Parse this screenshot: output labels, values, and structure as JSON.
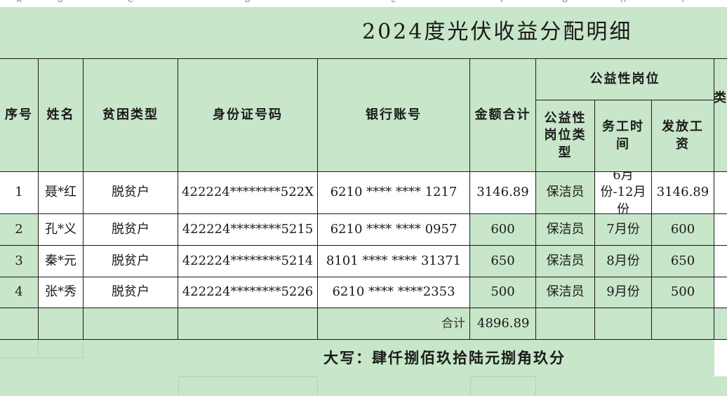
{
  "column_letters": [
    "A",
    "B",
    "C",
    "D",
    "E",
    "F",
    "G",
    "H",
    "I"
  ],
  "title": "2024度光伏收益分配明细",
  "headers": {
    "seq": "序号",
    "name": "姓名",
    "poverty_type": "贫困类型",
    "id_number": "身份证号码",
    "bank_account": "银行账号",
    "amount_total": "金额合计",
    "public_post_group": "公益性岗位",
    "post_type": "公益性岗位类型",
    "work_time": "务工时间",
    "wage": "发放工资",
    "clipped": "类"
  },
  "rows": [
    {
      "seq": "1",
      "name": "聂*红",
      "poverty_type": "脱贫户",
      "id_number": "422224********522X",
      "bank_account": "6210 **** **** 1217",
      "amount": "3146.89",
      "post_type": "保洁员",
      "work_time": "6月份-12月份",
      "wage": "3146.89"
    },
    {
      "seq": "2",
      "name": "孔*义",
      "poverty_type": "脱贫户",
      "id_number": "422224********5215",
      "bank_account": "6210 **** **** 0957",
      "amount": "600",
      "post_type": "保洁员",
      "work_time": "7月份",
      "wage": "600"
    },
    {
      "seq": "3",
      "name": "秦*元",
      "poverty_type": "脱贫户",
      "id_number": "422224********5214",
      "bank_account": "8101 **** **** 31371",
      "amount": "650",
      "post_type": "保洁员",
      "work_time": "8月份",
      "wage": "650"
    },
    {
      "seq": "4",
      "name": "张*秀",
      "poverty_type": "脱贫户",
      "id_number": "422224********5226",
      "bank_account": "6210 **** ****2353",
      "amount": "500",
      "post_type": "保洁员",
      "work_time": "9月份",
      "wage": "500"
    }
  ],
  "total_label": "合计",
  "total_value": "4896.89",
  "capital_text": "大写：肆仟捌佰玖拾陆元捌角玖分"
}
